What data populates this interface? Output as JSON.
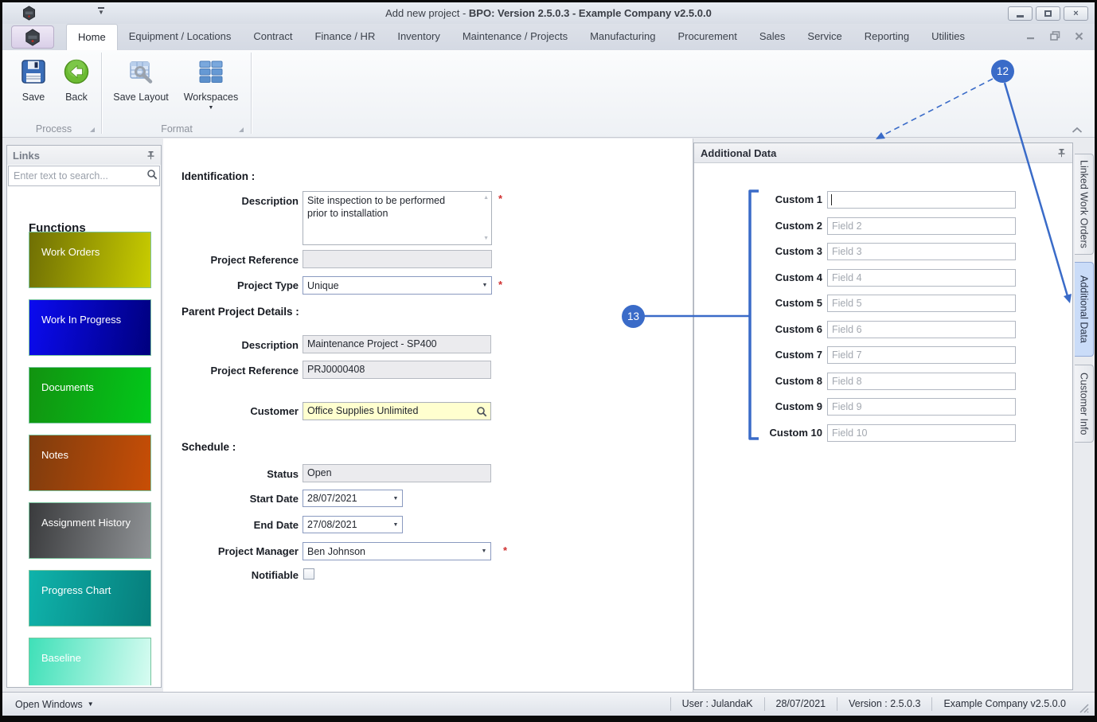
{
  "title_bar": {
    "title_prefix": "Add new project - ",
    "title_main": "BPO: Version 2.5.0.3 - Example Company v2.5.0.0"
  },
  "ribbon": {
    "tabs": [
      "Home",
      "Equipment / Locations",
      "Contract",
      "Finance / HR",
      "Inventory",
      "Maintenance / Projects",
      "Manufacturing",
      "Procurement",
      "Sales",
      "Service",
      "Reporting",
      "Utilities"
    ],
    "active_tab": "Home",
    "buttons": {
      "save": "Save",
      "back": "Back",
      "save_layout": "Save Layout",
      "workspaces": "Workspaces"
    },
    "groups": {
      "process": "Process",
      "format": "Format"
    }
  },
  "links_panel": {
    "title": "Links",
    "search_placeholder": "Enter text to search...",
    "section_title": "Functions",
    "tiles": [
      {
        "label": "Work Orders",
        "from": "#6f6f04",
        "to": "#c9cd00"
      },
      {
        "label": "Work In Progress",
        "from": "#0b0bf0",
        "to": "#00007e"
      },
      {
        "label": "Documents",
        "from": "#129310",
        "to": "#02c81a"
      },
      {
        "label": "Notes",
        "from": "#7e3c0e",
        "to": "#c84e06"
      },
      {
        "label": "Assignment History",
        "from": "#3a3b3d",
        "to": "#909396"
      },
      {
        "label": "Progress Chart",
        "from": "#0fb3ab",
        "to": "#067d7b"
      },
      {
        "label": "Baseline",
        "from": "#3fe0b8",
        "to": "#d9fcf2"
      }
    ]
  },
  "form": {
    "identification_header": "Identification :",
    "description_label": "Description",
    "description_value": "Site inspection to be performed prior to installation",
    "project_reference_label": "Project Reference",
    "project_reference_value": "",
    "project_type_label": "Project Type",
    "project_type_value": "Unique",
    "parent_header": "Parent Project Details :",
    "parent_description_label": "Description",
    "parent_description_value": "Maintenance Project - SP400",
    "parent_reference_label": "Project Reference",
    "parent_reference_value": "PRJ0000408",
    "customer_label": "Customer",
    "customer_value": "Office Supplies Unlimited",
    "schedule_header": "Schedule :",
    "status_label": "Status",
    "status_value": "Open",
    "start_date_label": "Start Date",
    "start_date_value": "28/07/2021",
    "end_date_label": "End Date",
    "end_date_value": "27/08/2021",
    "project_manager_label": "Project Manager",
    "project_manager_value": "Ben Johnson",
    "notifiable_label": "Notifiable",
    "required_marker": "*"
  },
  "additional_panel": {
    "title": "Additional Data",
    "fields": [
      {
        "label": "Custom 1",
        "value": "",
        "placeholder": ""
      },
      {
        "label": "Custom 2",
        "placeholder": "Field 2"
      },
      {
        "label": "Custom 3",
        "placeholder": "Field 3"
      },
      {
        "label": "Custom 4",
        "placeholder": "Field 4"
      },
      {
        "label": "Custom 5",
        "placeholder": "Field 5"
      },
      {
        "label": "Custom 6",
        "placeholder": "Field 6"
      },
      {
        "label": "Custom 7",
        "placeholder": "Field 7"
      },
      {
        "label": "Custom 8",
        "placeholder": "Field 8"
      },
      {
        "label": "Custom 9",
        "placeholder": "Field 9"
      },
      {
        "label": "Custom 10",
        "placeholder": "Field 10"
      }
    ]
  },
  "side_tabs": {
    "tabs": [
      "Linked Work Orders",
      "Additional Data",
      "Customer Info"
    ],
    "active": "Additional Data"
  },
  "status_bar": {
    "open_windows": "Open Windows",
    "user": "User : JulandaK",
    "date": "28/07/2021",
    "version": "Version : 2.5.0.3",
    "company": "Example Company v2.5.0.0"
  },
  "callouts": {
    "c12": "12",
    "c13": "13"
  },
  "icons": {
    "dropdown_glyph": "▼",
    "caret_glyph": "▼",
    "scroll_up": "▲",
    "scroll_down": "▼",
    "close_glyph": "×"
  },
  "colors": {
    "accent_blue": "#3a6bc8",
    "required_red": "#d03030",
    "customer_field_bg": "#ffffcf"
  }
}
